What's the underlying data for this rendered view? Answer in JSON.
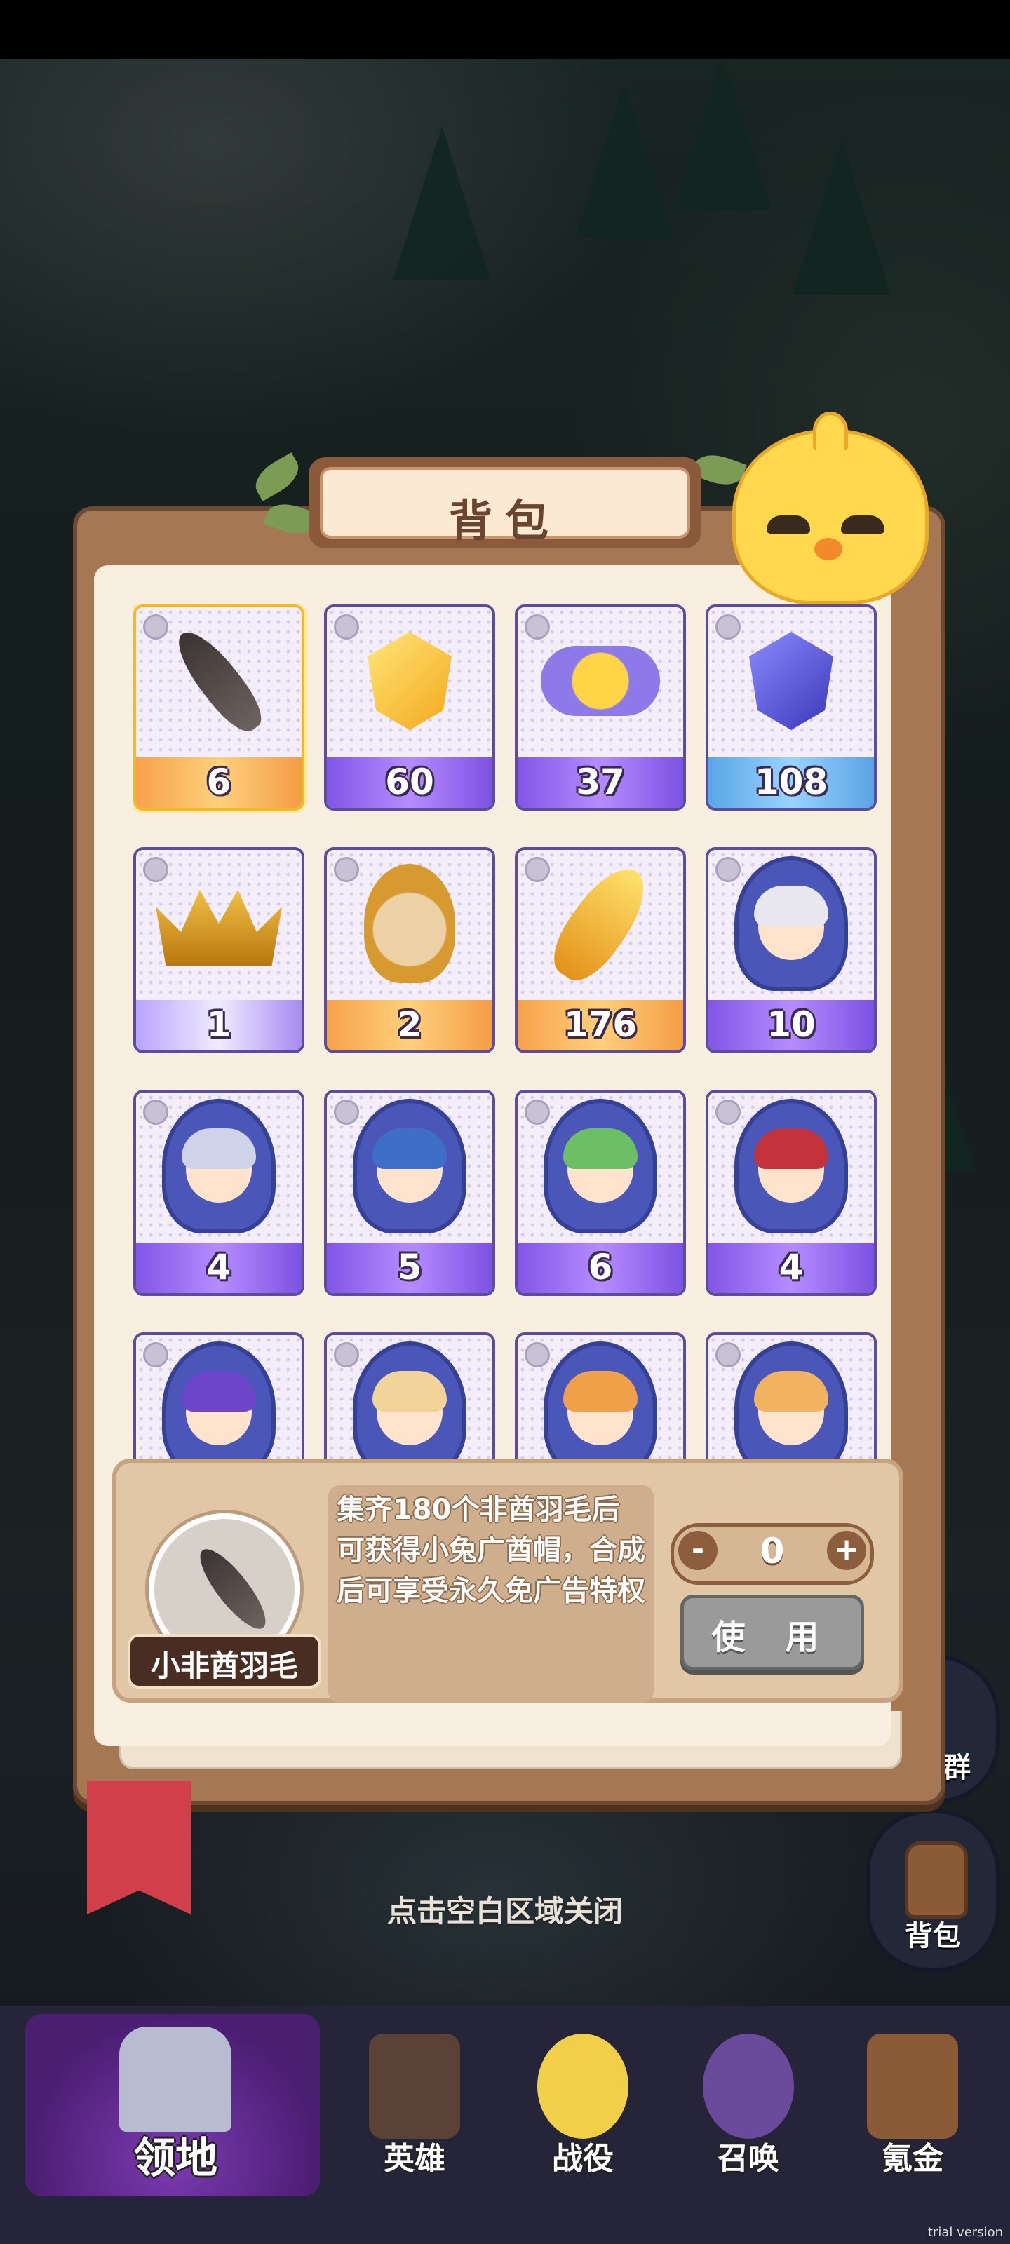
{
  "panel": {
    "title": "背包"
  },
  "items": [
    {
      "name": "feather",
      "count": "6",
      "rarity": "orange",
      "icon": "feather-icon",
      "selected": true
    },
    {
      "name": "gold-crystal",
      "count": "60",
      "rarity": "purple",
      "icon": "gold-crystal-icon"
    },
    {
      "name": "candy",
      "count": "37",
      "rarity": "purple",
      "icon": "candy-icon"
    },
    {
      "name": "blue-crystal",
      "count": "108",
      "rarity": "blue",
      "icon": "blue-crystal-icon"
    },
    {
      "name": "crown",
      "count": "1",
      "rarity": "lilac",
      "icon": "crown-icon"
    },
    {
      "name": "gold-hero-frame",
      "count": "2",
      "rarity": "orange",
      "icon": "hero-frame-icon"
    },
    {
      "name": "gold-feather",
      "count": "176",
      "rarity": "orange",
      "icon": "gold-feather-icon"
    },
    {
      "name": "hero-shard-white",
      "count": "10",
      "rarity": "purple",
      "icon": "hero-shard-icon",
      "hair": "#e8e6ef"
    },
    {
      "name": "hero-shard-silver",
      "count": "4",
      "rarity": "purple",
      "icon": "hero-shard-icon",
      "hair": "#cfd3ea"
    },
    {
      "name": "hero-shard-blue",
      "count": "5",
      "rarity": "purple",
      "icon": "hero-shard-icon",
      "hair": "#3f6ec7"
    },
    {
      "name": "hero-shard-green",
      "count": "6",
      "rarity": "purple",
      "icon": "hero-shard-icon",
      "hair": "#6cbf62"
    },
    {
      "name": "hero-shard-red",
      "count": "4",
      "rarity": "purple",
      "icon": "hero-shard-icon",
      "hair": "#c2333c"
    },
    {
      "name": "hero-shard-violet",
      "count": "",
      "rarity": "purple",
      "icon": "hero-shard-icon",
      "hair": "#6d45c9"
    },
    {
      "name": "hero-shard-blonde",
      "count": "",
      "rarity": "purple",
      "icon": "hero-shard-icon",
      "hair": "#f2d39a"
    },
    {
      "name": "hero-shard-orange",
      "count": "",
      "rarity": "purple",
      "icon": "hero-shard-icon",
      "hair": "#f0a048"
    },
    {
      "name": "hero-shard-peach",
      "count": "",
      "rarity": "purple",
      "icon": "hero-shard-icon",
      "hair": "#f2b360"
    }
  ],
  "detail": {
    "item_name": "小非酋羽毛",
    "description": "集齐180个非酋羽毛后可获得小兔广酋帽，合成后可享受永久免广告特权",
    "quantity": "0",
    "minus": "-",
    "plus": "+",
    "use_label": "使 用"
  },
  "hint": "点击空白区域关闭",
  "side": {
    "qq_label": "QQ群",
    "bag_label": "背包"
  },
  "nav": [
    {
      "label": "领地",
      "key": "territory"
    },
    {
      "label": "英雄",
      "key": "heroes"
    },
    {
      "label": "战役",
      "key": "campaign"
    },
    {
      "label": "召唤",
      "key": "summon"
    },
    {
      "label": "氪金",
      "key": "shop"
    }
  ],
  "watermark": "trial version"
}
